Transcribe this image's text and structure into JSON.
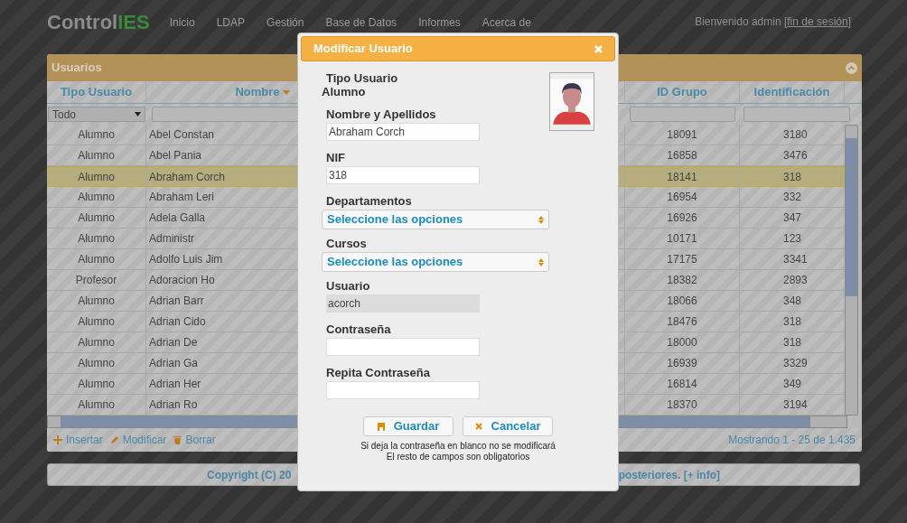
{
  "header": {
    "logo": [
      "Control",
      "IES"
    ],
    "nav": [
      "Inicio",
      "LDAP",
      "Gestión",
      "Base de Datos",
      "Informes",
      "Acerca de"
    ],
    "welcome": "Bienvenido admin [",
    "logout": "fin de sesión",
    "welcome_end": "]"
  },
  "grid": {
    "title": "Usuarios",
    "columns": [
      {
        "label": "Tipo Usuario",
        "sorted": false
      },
      {
        "label": "Nombre",
        "sorted": true
      },
      {
        "label": "ID Grupo",
        "sorted": false
      },
      {
        "label": "Identificación",
        "sorted": false
      }
    ],
    "filter": {
      "value": "Todo"
    },
    "rows": [
      {
        "tipo": "Alumno",
        "nombre": "Abel Constan",
        "id_grupo": "18091",
        "identificacion": "3180",
        "selected": false
      },
      {
        "tipo": "Alumno",
        "nombre": "Abel Pania",
        "id_grupo": "16858",
        "identificacion": "3476",
        "selected": false
      },
      {
        "tipo": "Alumno",
        "nombre": "Abraham Corch",
        "id_grupo": "18141",
        "identificacion": "318",
        "selected": true
      },
      {
        "tipo": "Alumno",
        "nombre": "Abraham Leri",
        "id_grupo": "16954",
        "identificacion": "332",
        "selected": false
      },
      {
        "tipo": "Alumno",
        "nombre": "Adela Galla",
        "id_grupo": "16926",
        "identificacion": "347",
        "selected": false
      },
      {
        "tipo": "Alumno",
        "nombre": "Administr",
        "id_grupo": "10171",
        "identificacion": "123",
        "selected": false
      },
      {
        "tipo": "Alumno",
        "nombre": "Adolfo Luis Jim",
        "id_grupo": "17175",
        "identificacion": "3341",
        "selected": false
      },
      {
        "tipo": "Profesor",
        "nombre": "Adoracion Ho",
        "id_grupo": "18382",
        "identificacion": "2893",
        "selected": false
      },
      {
        "tipo": "Alumno",
        "nombre": "Adrian Barr",
        "id_grupo": "18066",
        "identificacion": "348",
        "selected": false
      },
      {
        "tipo": "Alumno",
        "nombre": "Adrian Cido",
        "id_grupo": "18476",
        "identificacion": "318",
        "selected": false
      },
      {
        "tipo": "Alumno",
        "nombre": "Adrian De",
        "id_grupo": "18000",
        "identificacion": "318",
        "selected": false
      },
      {
        "tipo": "Alumno",
        "nombre": "Adrian Ga",
        "id_grupo": "16939",
        "identificacion": "3329",
        "selected": false
      },
      {
        "tipo": "Alumno",
        "nombre": "Adrian Her",
        "id_grupo": "16814",
        "identificacion": "349",
        "selected": false
      },
      {
        "tipo": "Alumno",
        "nombre": "Adrian Ro",
        "id_grupo": "18370",
        "identificacion": "3194",
        "selected": false
      }
    ],
    "actions": [
      {
        "kind": "add",
        "label": "Insertar"
      },
      {
        "kind": "edit",
        "label": "Modificar"
      },
      {
        "kind": "delete",
        "label": "Borrar"
      }
    ],
    "pager": "Mostrando 1 - 25 de 1.435"
  },
  "footer": {
    "left": "Copyright (C) 20",
    "right": "posteriores. [+ info]"
  },
  "modal": {
    "title": "Modificar Usuario",
    "tipo_label": "Tipo Usuario",
    "tipo_value": "Alumno",
    "fields": [
      {
        "kind": "text",
        "label": "Nombre y Apellidos",
        "value": "Abraham Corch"
      },
      {
        "kind": "text",
        "label": "NIF",
        "value": "318"
      },
      {
        "kind": "select",
        "label": "Departamentos",
        "value": "Seleccione las opciones"
      },
      {
        "kind": "select",
        "label": "Cursos",
        "value": "Seleccione las opciones"
      },
      {
        "kind": "readonly",
        "label": "Usuario",
        "value": "acorch"
      },
      {
        "kind": "password",
        "label": "Contraseña"
      },
      {
        "kind": "password",
        "label": "Repita Contraseña"
      }
    ],
    "buttons": [
      {
        "kind": "save",
        "label": "Guardar"
      },
      {
        "kind": "cancel",
        "label": "Cancelar"
      }
    ],
    "notes": [
      "Si deja la contraseña en blanco no se modificará",
      "El resto de campos son obligatorios"
    ]
  }
}
